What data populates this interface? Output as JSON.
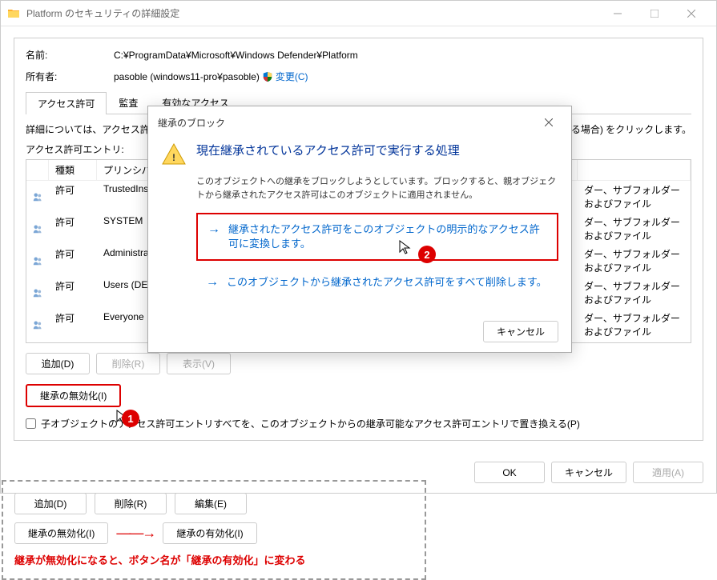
{
  "window": {
    "title": "Platform のセキュリティの詳細設定",
    "name_label": "名前:",
    "name_value": "C:¥ProgramData¥Microsoft¥Windows Defender¥Platform",
    "owner_label": "所有者:",
    "owner_value": "pasoble (windows11-pro¥pasoble)",
    "change_link": "変更(C)"
  },
  "tabs": {
    "permissions": "アクセス許可",
    "audit": "監査",
    "effective": "有効なアクセス"
  },
  "description": "詳細については、アクセス許可",
  "description_suffix": "きる場合) をクリックします。",
  "entries_label": "アクセス許可エントリ:",
  "grid": {
    "headers": {
      "type": "種類",
      "principal": "プリンシパル",
      "access": "",
      "apply": ""
    },
    "rows": [
      {
        "type": "許可",
        "principal": "TrustedInst",
        "apply": "ダー、サブフォルダーおよびファイル"
      },
      {
        "type": "許可",
        "principal": "SYSTEM",
        "apply": "ダー、サブフォルダーおよびファイル"
      },
      {
        "type": "許可",
        "principal": "Administra",
        "apply": "ダー、サブフォルダーおよびファイル"
      },
      {
        "type": "許可",
        "principal": "Users (DES",
        "apply": "ダー、サブフォルダーおよびファイル"
      },
      {
        "type": "許可",
        "principal": "Everyone",
        "apply": "ダー、サブフォルダーおよびファイル"
      }
    ]
  },
  "buttons": {
    "add": "追加(D)",
    "remove": "削除(R)",
    "view": "表示(V)",
    "disable_inherit": "継承の無効化(I)",
    "ok": "OK",
    "cancel": "キャンセル",
    "apply": "適用(A)"
  },
  "checkbox_label": "子オブジェクトのアクセス許可エントリすべてを、このオブジェクトからの継承可能なアクセス許可エントリで置き換える(P)",
  "modal": {
    "title": "継承のブロック",
    "heading": "現在継承されているアクセス許可で実行する処理",
    "text": "このオブジェクトへの継承をブロックしようとしています。ブロックすると、親オブジェクトから継承されたアクセス許可はこのオブジェクトに適用されません。",
    "option1": "継承されたアクセス許可をこのオブジェクトの明示的なアクセス許可に変換します。",
    "option2": "このオブジェクトから継承されたアクセス許可をすべて削除します。",
    "cancel": "キャンセル"
  },
  "badges": {
    "b1": "1",
    "b2": "2"
  },
  "tutorial": {
    "add": "追加(D)",
    "remove": "削除(R)",
    "edit": "編集(E)",
    "disable": "継承の無効化(I)",
    "enable": "継承の有効化(I)",
    "note": "継承が無効化になると、ボタン名が「継承の有効化」に変わる"
  }
}
